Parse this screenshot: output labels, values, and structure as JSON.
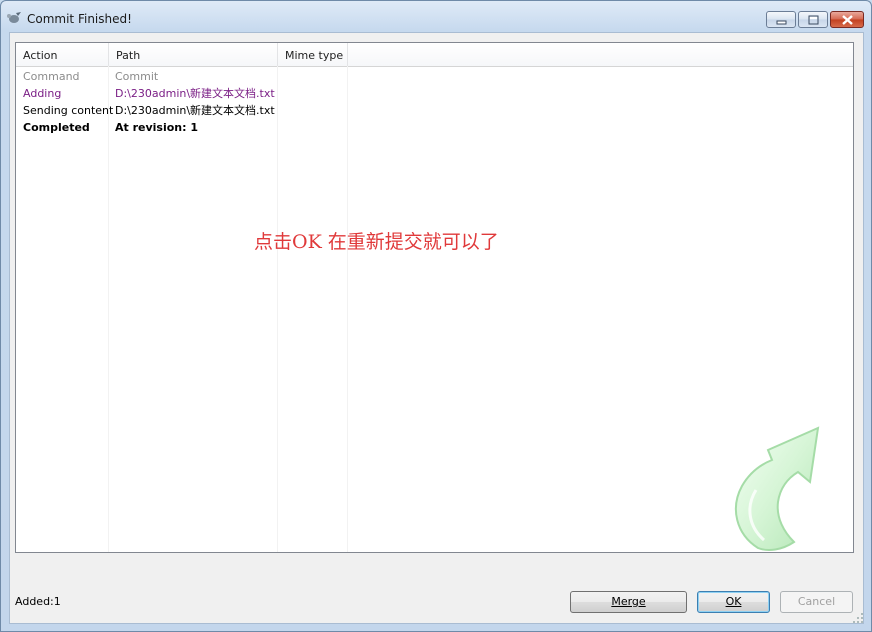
{
  "window": {
    "title": "Commit Finished!"
  },
  "table": {
    "columns": [
      "Action",
      "Path",
      "Mime type"
    ],
    "rows": [
      {
        "action": "Command",
        "path": "Commit",
        "style": "gray"
      },
      {
        "action": "Adding",
        "path": "D:\\230admin\\新建文本文档.txt",
        "style": "purple"
      },
      {
        "action": "Sending content",
        "path": "D:\\230admin\\新建文本文档.txt",
        "style": "black"
      },
      {
        "action": "Completed",
        "path": "At revision: 1",
        "style": "bold"
      }
    ]
  },
  "annotation": {
    "text": "点击OK 在重新提交就可以了",
    "color": "#e0393a"
  },
  "status": {
    "text": "Added:1"
  },
  "buttons": {
    "merge": "Merge",
    "ok": "OK",
    "cancel": "Cancel"
  },
  "icons": {
    "app": "tortoisesvn-icon",
    "decoration": "green-curved-arrow-icon"
  }
}
